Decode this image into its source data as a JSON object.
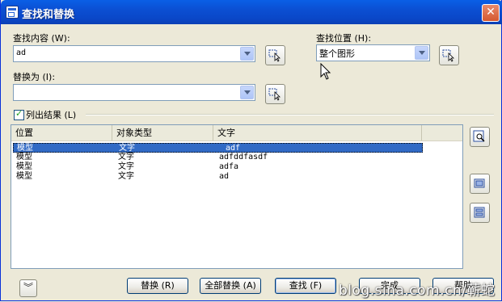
{
  "window": {
    "title": "查找和替换"
  },
  "find": {
    "label": "查找内容 (W):",
    "value": "ad"
  },
  "replace": {
    "label": "替换为 (I):",
    "value": ""
  },
  "location": {
    "label": "查找位置 (H):",
    "value": "整个图形"
  },
  "list_results": {
    "label": "列出结果 (L)",
    "checked": true
  },
  "results": {
    "columns": [
      "位置",
      "对象类型",
      "文字"
    ],
    "rows": [
      {
        "location": "模型",
        "type": "文字",
        "text": "adf"
      },
      {
        "location": "模型",
        "type": "文字",
        "text": "adfddfasdf"
      },
      {
        "location": "模型",
        "type": "文字",
        "text": "adfa"
      },
      {
        "location": "模型",
        "type": "文字",
        "text": "ad"
      }
    ],
    "selected_index": 0
  },
  "buttons": {
    "replace": "替换 (R)",
    "replace_all": "全部替换 (A)",
    "find": "查找 (F)",
    "done": "完成",
    "help": "帮助",
    "expand_icon": "chevron-double-down-icon"
  },
  "watermark": "blog.sina.com.cn/蕲蛇"
}
